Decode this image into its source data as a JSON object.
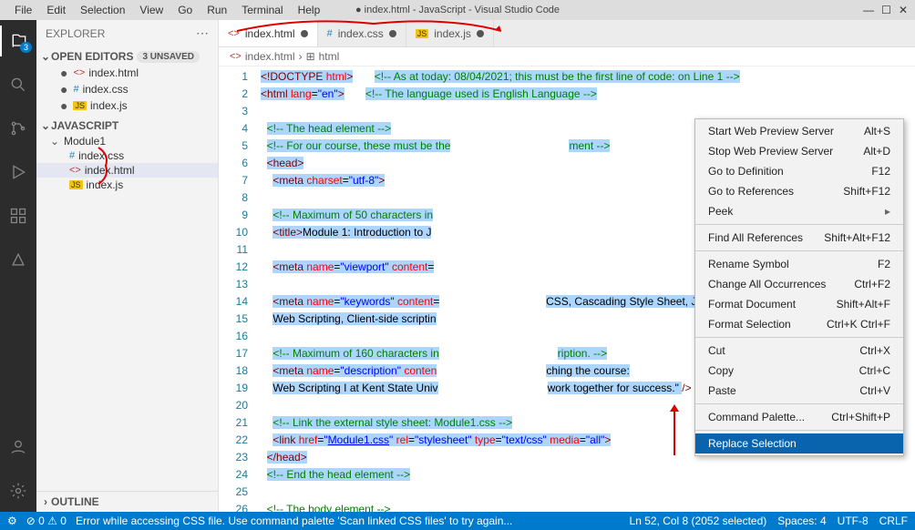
{
  "title": "● index.html - JavaScript - Visual Studio Code",
  "menu": [
    "File",
    "Edit",
    "Selection",
    "View",
    "Go",
    "Run",
    "Terminal",
    "Help"
  ],
  "explorer": {
    "title": "EXPLORER",
    "openEditors": {
      "label": "OPEN EDITORS",
      "badge": "3 UNSAVED"
    },
    "openEditorsItems": [
      {
        "name": "index.html",
        "icon": "html",
        "dirty": true
      },
      {
        "name": "index.css",
        "icon": "css",
        "dirty": true
      },
      {
        "name": "index.js",
        "icon": "js",
        "dirty": true
      }
    ],
    "folder": "JAVASCRIPT",
    "subfolder": "Module1",
    "files": [
      {
        "name": "index.css",
        "icon": "css"
      },
      {
        "name": "index.html",
        "icon": "html",
        "selected": true
      },
      {
        "name": "index.js",
        "icon": "js"
      }
    ],
    "outline": "OUTLINE"
  },
  "activityBadge": "3",
  "tabs": [
    {
      "name": "index.html",
      "icon": "html",
      "active": true,
      "dirty": true
    },
    {
      "name": "index.css",
      "icon": "css",
      "active": false,
      "dirty": true
    },
    {
      "name": "index.js",
      "icon": "js",
      "active": false,
      "dirty": true
    }
  ],
  "breadcrumb": [
    "index.html",
    "html"
  ],
  "code": {
    "lines": [
      {
        "n": 1,
        "html": "<span class='sel-bg'><span class='c-tag'>&lt;!DOCTYPE </span><span class='c-attr'>html</span><span class='c-tag'>&gt;</span></span>       <span class='sel-bg'><span class='c-cmt'>&lt;!-- As at today: 08/04/2021; this must be the first line of code: on Line 1 --&gt;</span></span>"
      },
      {
        "n": 2,
        "html": "<span class='sel-bg'><span class='c-tag'>&lt;html </span><span class='c-attr'>lang</span>=<span class='c-str'>\"en\"</span><span class='c-tag'>&gt;</span></span>       <span class='sel-bg'><span class='c-cmt'>&lt;!-- The language used is English Language --&gt;</span></span>"
      },
      {
        "n": 3,
        "html": ""
      },
      {
        "n": 4,
        "html": "  <span class='sel-bg'><span class='c-cmt'>&lt;!-- The head element --&gt;</span></span>"
      },
      {
        "n": 5,
        "html": "  <span class='sel-bg'><span class='c-cmt'>&lt;!-- For our course, these must be the</span></span>                                       <span class='sel-bg'><span class='c-cmt'>ment --&gt;</span></span>"
      },
      {
        "n": 6,
        "html": "  <span class='sel-bg'><span class='c-tag'>&lt;head&gt;</span></span>"
      },
      {
        "n": 7,
        "html": "    <span class='sel-bg'><span class='c-tag'>&lt;meta </span><span class='c-attr'>charset</span>=<span class='c-str'>\"utf-8\"</span><span class='c-tag'>&gt;</span></span>"
      },
      {
        "n": 8,
        "html": ""
      },
      {
        "n": 9,
        "html": "    <span class='sel-bg'><span class='c-cmt'>&lt;!-- Maximum of 50 characters in</span></span>"
      },
      {
        "n": 10,
        "html": "    <span class='sel-bg'><span class='c-tag'>&lt;title&gt;</span>Module 1: Introduction to J</span>"
      },
      {
        "n": 11,
        "html": ""
      },
      {
        "n": 12,
        "html": "    <span class='sel-bg'><span class='c-tag'>&lt;meta </span><span class='c-attr'>name</span>=<span class='c-str'>\"viewport\"</span> <span class='c-attr'>content</span>=</span>"
      },
      {
        "n": 13,
        "html": ""
      },
      {
        "n": 14,
        "html": "    <span class='sel-bg'><span class='c-tag'>&lt;meta </span><span class='c-attr'>name</span>=<span class='c-str'>\"keywords\"</span> <span class='c-attr'>content</span>=</span>                                   <span class='sel-bg'>CSS, Cascading Style Sheet, JavaScript,</span>"
      },
      {
        "n": 15,
        "html": "    <span class='sel-bg'>Web Scripting, Client-side scriptin</span>"
      },
      {
        "n": 16,
        "html": ""
      },
      {
        "n": 17,
        "html": "    <span class='sel-bg'><span class='c-cmt'>&lt;!-- Maximum of 160 characters in</span></span>                                       <span class='sel-bg'><span class='c-cmt'>ription. --&gt;</span></span>"
      },
      {
        "n": 18,
        "html": "    <span class='sel-bg'><span class='c-tag'>&lt;meta </span><span class='c-attr'>name</span>=<span class='c-str'>\"description\"</span> <span class='c-attr'>conten</span></span>                                    <span class='sel-bg'>ching the course:</span>"
      },
      {
        "n": 19,
        "html": "    <span class='sel-bg'>Web Scripting I at Kent State Univ</span>                                    <span class='sel-bg'>work together for success.\" </span><span class='c-tag'>/&gt;</span>"
      },
      {
        "n": 20,
        "html": ""
      },
      {
        "n": 21,
        "html": "    <span class='sel-bg'><span class='c-cmt'>&lt;!-- Link the external style sheet: Module1.css --&gt;</span></span>"
      },
      {
        "n": 22,
        "html": "    <span class='sel-bg'><span class='c-tag'>&lt;link </span><span class='c-attr'>href</span>=<span class='c-str'>\"<u>Module1.css</u>\"</span> <span class='c-attr'>rel</span>=<span class='c-str'>\"stylesheet\"</span> <span class='c-attr'>type</span>=<span class='c-str'>\"text/css\"</span> <span class='c-attr'>media</span>=<span class='c-str'>\"all\"</span><span class='c-tag'>&gt;</span></span>"
      },
      {
        "n": 23,
        "html": "  <span class='sel-bg'><span class='c-tag'>&lt;/head&gt;</span></span>"
      },
      {
        "n": 24,
        "html": "  <span class='sel-bg'><span class='c-cmt'>&lt;!-- End the head element --&gt;</span></span>"
      },
      {
        "n": 25,
        "html": ""
      },
      {
        "n": 26,
        "html": "  <span class='c-cmt'>&lt;!-- The body element --&gt;</span>"
      }
    ]
  },
  "contextMenu": [
    {
      "label": "Start Web Preview Server",
      "kbd": "Alt+S"
    },
    {
      "label": "Stop Web Preview Server",
      "kbd": "Alt+D"
    },
    {
      "label": "Go to Definition",
      "kbd": "F12"
    },
    {
      "label": "Go to References",
      "kbd": "Shift+F12"
    },
    {
      "label": "Peek",
      "kbd": "▸",
      "sub": true
    },
    {
      "sep": true
    },
    {
      "label": "Find All References",
      "kbd": "Shift+Alt+F12"
    },
    {
      "sep": true
    },
    {
      "label": "Rename Symbol",
      "kbd": "F2"
    },
    {
      "label": "Change All Occurrences",
      "kbd": "Ctrl+F2"
    },
    {
      "label": "Format Document",
      "kbd": "Shift+Alt+F"
    },
    {
      "label": "Format Selection",
      "kbd": "Ctrl+K Ctrl+F"
    },
    {
      "sep": true
    },
    {
      "label": "Cut",
      "kbd": "Ctrl+X"
    },
    {
      "label": "Copy",
      "kbd": "Ctrl+C"
    },
    {
      "label": "Paste",
      "kbd": "Ctrl+V"
    },
    {
      "sep": true
    },
    {
      "label": "Command Palette...",
      "kbd": "Ctrl+Shift+P"
    },
    {
      "sep": true
    },
    {
      "label": "Replace Selection",
      "kbd": "",
      "selected": true
    }
  ],
  "status": {
    "leftIcons": "⊘ 0 ⚠ 0",
    "error": "Error while accessing CSS file. Use command palette 'Scan linked CSS files' to try again...",
    "ln": "Ln 52, Col 8 (2052 selected)",
    "spaces": "Spaces: 4",
    "enc": "UTF-8",
    "eol": "CRLF"
  }
}
